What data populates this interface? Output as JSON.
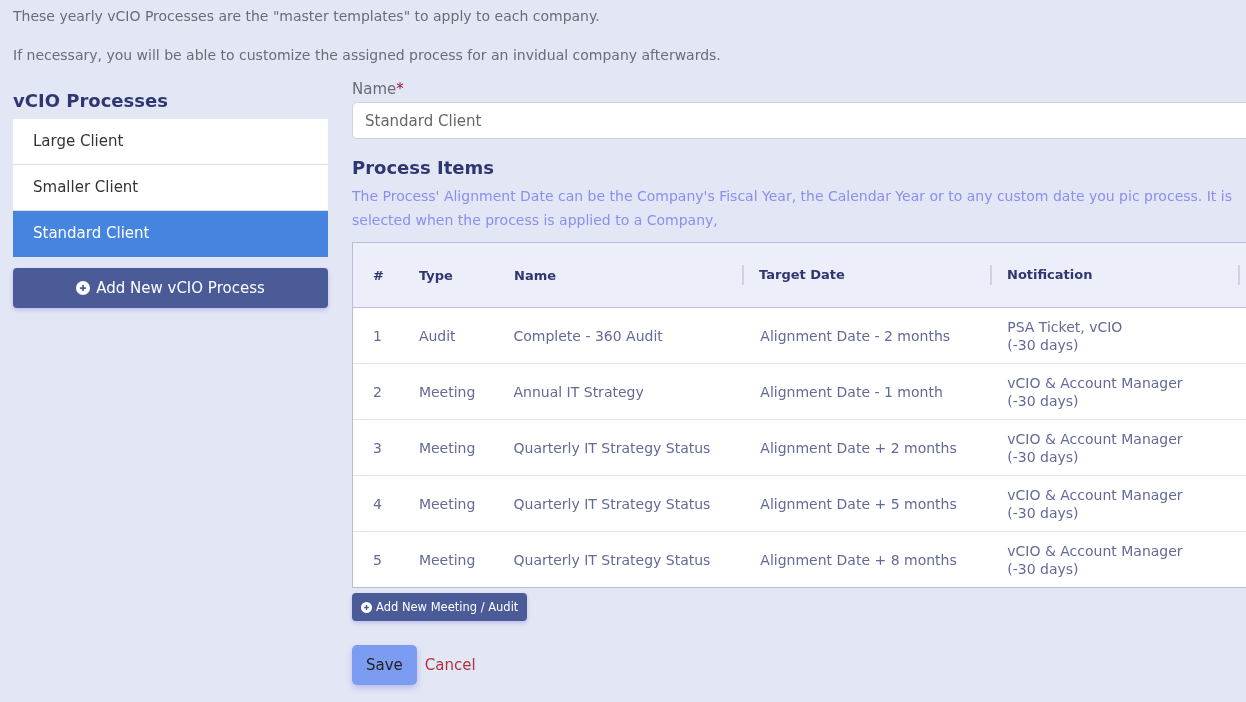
{
  "intro": [
    "These yearly vCIO Processes are the \"master templates\" to apply to each company.",
    "If necessary, you will be able to customize the assigned process for an invidual company afterwards."
  ],
  "sidebar": {
    "title": "vCIO Processes",
    "items": [
      {
        "label": "Large Client",
        "selected": false
      },
      {
        "label": "Smaller Client",
        "selected": false
      },
      {
        "label": "Standard Client",
        "selected": true
      }
    ],
    "add_button": "Add New vCIO Process"
  },
  "form": {
    "name_label": "Name",
    "required_mark": "*",
    "name_value": "Standard Client",
    "section_title": "Process Items",
    "description": "The Process' Alignment Date can be the Company's Fiscal Year, the Calendar Year or to any custom date you pic process. It is selected when the process is applied to a Company,",
    "table": {
      "columns": [
        "#",
        "Type",
        "Name",
        "Target Date",
        "Notification"
      ],
      "rows": [
        {
          "number": "1",
          "type": "Audit",
          "name": "Complete - 360 Audit",
          "target_date": "Alignment Date - 2 months",
          "notification": [
            "PSA Ticket, vCIO",
            "(-30 days)"
          ]
        },
        {
          "number": "2",
          "type": "Meeting",
          "name": "Annual IT Strategy",
          "target_date": "Alignment Date - 1 month",
          "notification": [
            "vCIO & Account Manager",
            "(-30 days)"
          ]
        },
        {
          "number": "3",
          "type": "Meeting",
          "name": "Quarterly IT Strategy Status",
          "target_date": "Alignment Date + 2 months",
          "notification": [
            "vCIO & Account Manager",
            "(-30 days)"
          ]
        },
        {
          "number": "4",
          "type": "Meeting",
          "name": "Quarterly IT Strategy Status",
          "target_date": "Alignment Date + 5 months",
          "notification": [
            "vCIO & Account Manager",
            "(-30 days)"
          ]
        },
        {
          "number": "5",
          "type": "Meeting",
          "name": "Quarterly IT Strategy Status",
          "target_date": "Alignment Date + 8 months",
          "notification": [
            "vCIO & Account Manager",
            "(-30 days)"
          ]
        }
      ]
    },
    "add_item_button": "Add New Meeting / Audit",
    "save_button": "Save",
    "cancel_link": "Cancel"
  }
}
